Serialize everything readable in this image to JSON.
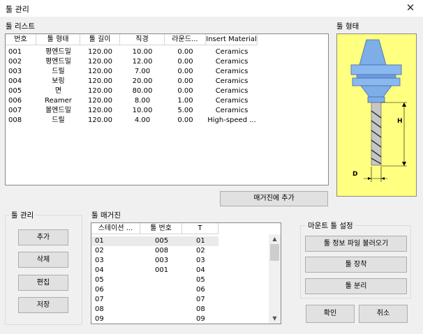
{
  "window": {
    "title": "툴 관리",
    "close_glyph": "✕"
  },
  "tool_list": {
    "label": "툴 리스트",
    "columns": [
      "번호",
      "툴 형태",
      "툴 길이",
      "직경",
      "라운드...",
      "Insert Material"
    ],
    "rows": [
      [
        "001",
        "평엔드밀",
        "120.00",
        "10.00",
        "0.00",
        "Ceramics"
      ],
      [
        "002",
        "평엔드밀",
        "120.00",
        "12.00",
        "0.00",
        "Ceramics"
      ],
      [
        "003",
        "드릴",
        "120.00",
        "7.00",
        "0.00",
        "Ceramics"
      ],
      [
        "004",
        "보링",
        "120.00",
        "20.00",
        "0.00",
        "Ceramics"
      ],
      [
        "005",
        "면",
        "120.00",
        "80.00",
        "0.00",
        "Ceramics"
      ],
      [
        "006",
        "Reamer",
        "120.00",
        "8.00",
        "1.00",
        "Ceramics"
      ],
      [
        "007",
        "볼엔드밀",
        "120.00",
        "10.00",
        "5.00",
        "Ceramics"
      ],
      [
        "008",
        "드릴",
        "120.00",
        "4.00",
        "0.00",
        "High-speed ..."
      ]
    ]
  },
  "tool_shape": {
    "label": "툴 형태",
    "dim_h": "H",
    "dim_d": "D"
  },
  "add_to_magazine_button": "매거진에 추가",
  "tool_management": {
    "label": "툴 관리",
    "buttons": {
      "add": "추가",
      "delete": "삭제",
      "edit": "편집",
      "save": "저장"
    }
  },
  "tool_magazine": {
    "label": "툴 매거진",
    "columns": [
      "스테이션 ...",
      "툴 번호",
      "T"
    ],
    "rows": [
      [
        "01",
        "005",
        "01"
      ],
      [
        "02",
        "008",
        "02"
      ],
      [
        "03",
        "003",
        "03"
      ],
      [
        "04",
        "001",
        "04"
      ],
      [
        "05",
        "",
        "05"
      ],
      [
        "06",
        "",
        "06"
      ],
      [
        "07",
        "",
        "07"
      ],
      [
        "08",
        "",
        "08"
      ],
      [
        "09",
        "",
        "09"
      ]
    ]
  },
  "mount_settings": {
    "label": "마운트 툴 설정",
    "buttons": {
      "load": "툴 정보 파일 불러오기",
      "mount": "툴 장착",
      "detach": "툴 분리"
    }
  },
  "dialog_buttons": {
    "ok": "확인",
    "cancel": "취소"
  },
  "colors": {
    "shape_background": "#ffff80",
    "tool_holder": "#7eaee8",
    "selection": "#eaeaea",
    "button_face": "#e1e1e1"
  }
}
